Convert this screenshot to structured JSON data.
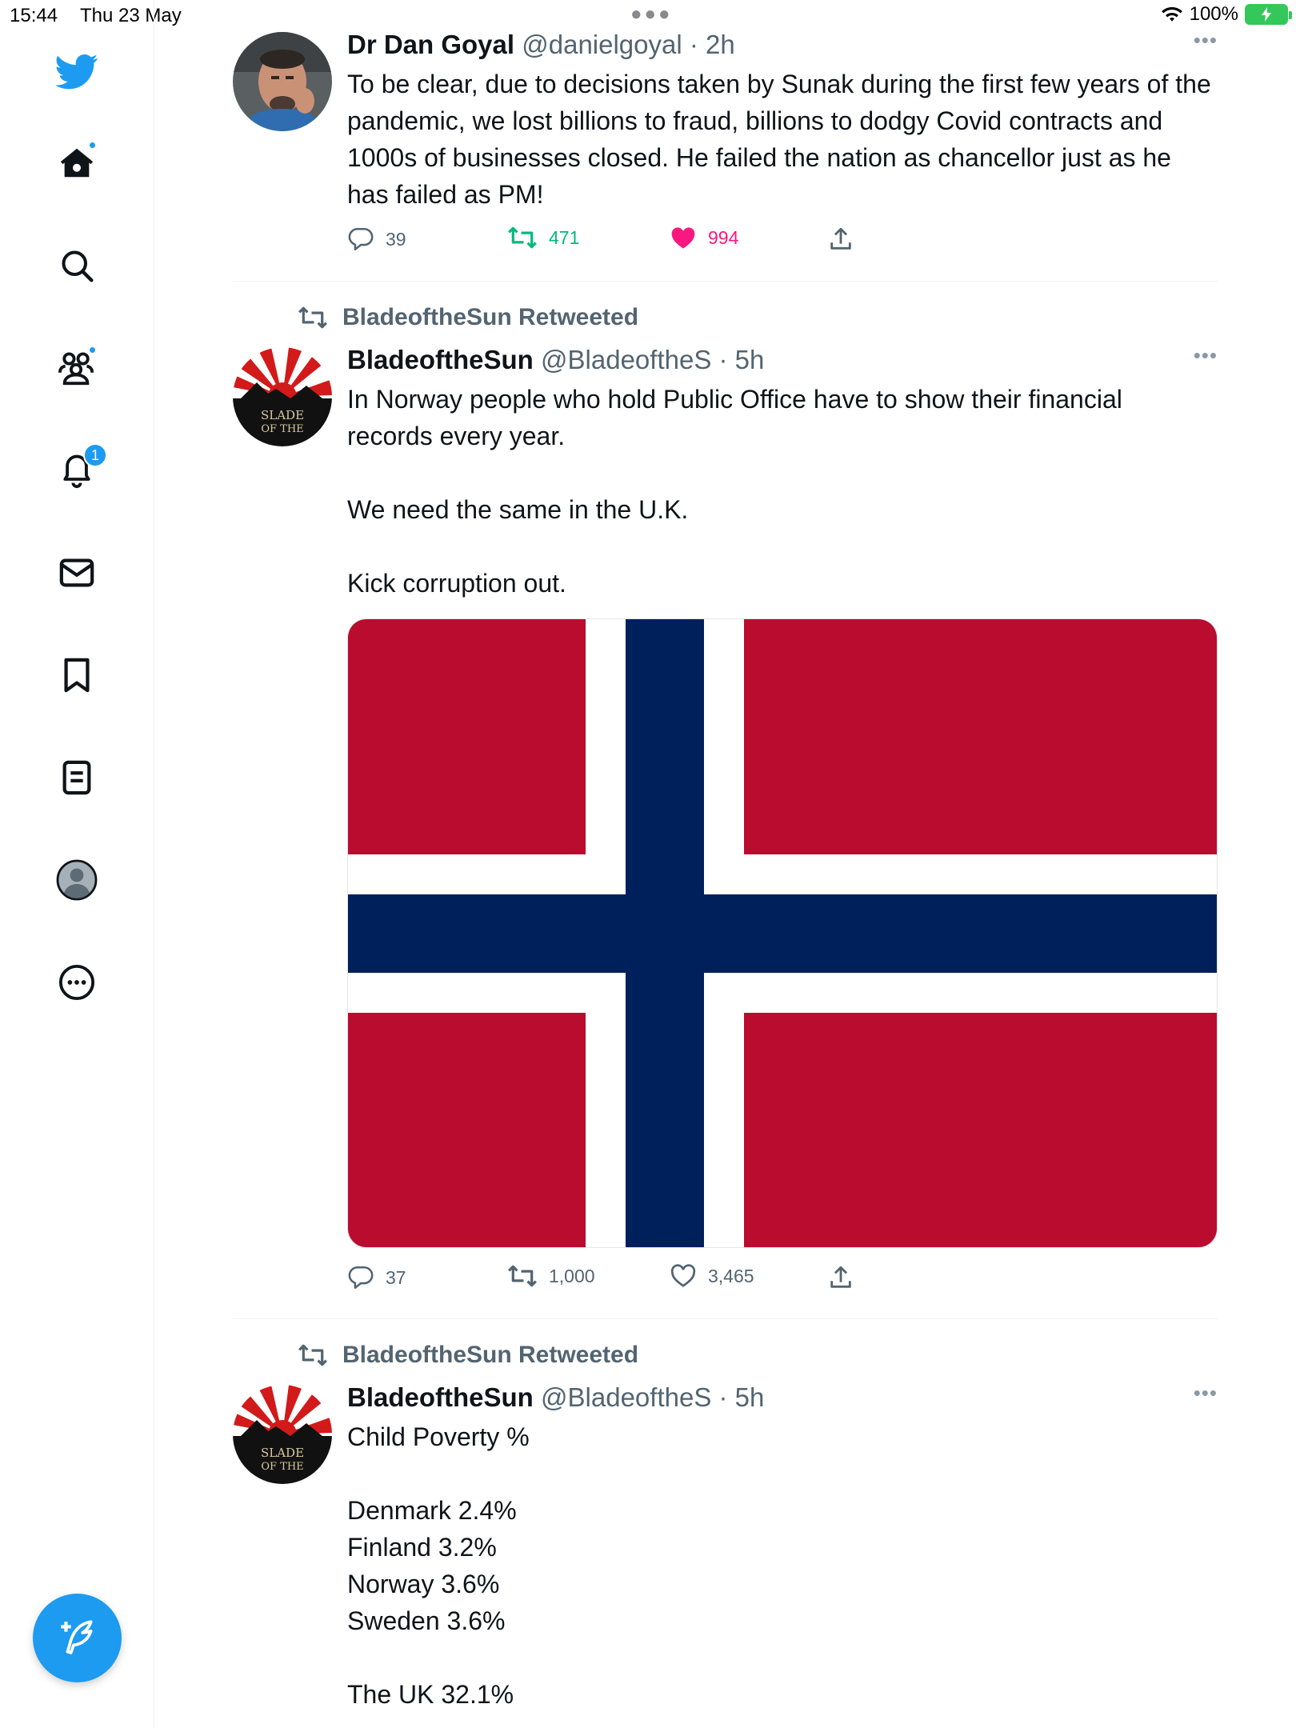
{
  "status_bar": {
    "time": "15:44",
    "date": "Thu 23 May",
    "battery": "100%"
  },
  "sidebar": {
    "notification_count": "1",
    "accent_color": "#1d9bf0",
    "icons": [
      "twitter-bird-icon",
      "home-icon",
      "search-icon",
      "communities-icon",
      "notifications-icon",
      "messages-icon",
      "bookmarks-icon",
      "lists-icon",
      "profile-icon",
      "more-icon",
      "compose-icon"
    ]
  },
  "tweets": [
    {
      "name": "Dr Dan Goyal",
      "handle": "@danielgoyal",
      "time": "· 2h",
      "text": "To be clear, due to decisions taken by Sunak during the first few years of the pandemic, we lost billions to fraud, billions to dodgy Covid contracts and 1000s of businesses closed. He failed the nation as chancellor just as he has failed as PM!",
      "replies": "39",
      "retweets": "471",
      "likes": "994"
    },
    {
      "retweeted_by": "BladeoftheSun Retweeted",
      "name": "BladeoftheSun",
      "handle": "@BladeoftheS",
      "time": "· 5h",
      "text": "In Norway people who hold Public Office have to show their financial records every year.\n\nWe need the same in the U.K.\n\nKick corruption out.",
      "replies": "37",
      "retweets": "1,000",
      "likes": "3,465",
      "media": "norway-flag"
    },
    {
      "retweeted_by": "BladeoftheSun Retweeted",
      "name": "BladeoftheSun",
      "handle": "@BladeoftheS",
      "time": "· 5h",
      "text": "Child Poverty %\n\nDenmark 2.4%\nFinland 3.2%\nNorway 3.6%\nSweden 3.6%\n\nThe UK 32.1%"
    }
  ],
  "avatar_text": "SLADE OF THE"
}
